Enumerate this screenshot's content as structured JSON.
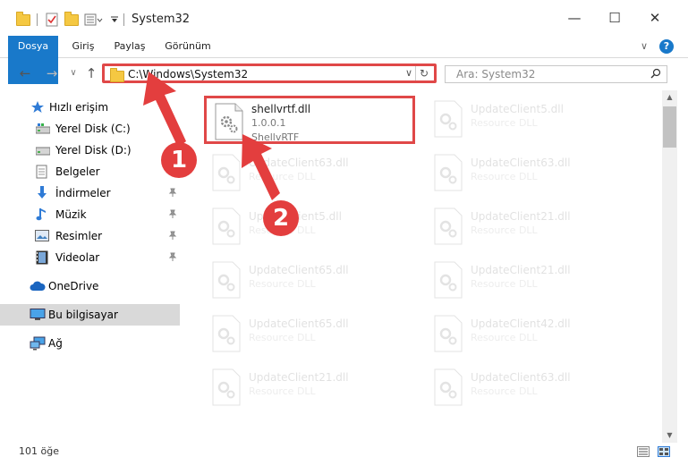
{
  "window": {
    "title": "System32",
    "controls": {
      "minimize": "—",
      "maximize": "☐",
      "close": "✕"
    }
  },
  "ribbon": {
    "tabs": [
      "Dosya",
      "Giriş",
      "Paylaş",
      "Görünüm"
    ],
    "expand": "∨",
    "help": "?"
  },
  "navigation": {
    "back": "←",
    "forward": "→",
    "recent": "∨",
    "up": "↑"
  },
  "address": {
    "path": "C:\\Windows\\System32",
    "dropdown": "∨",
    "refresh": "↻"
  },
  "search": {
    "placeholder": "Ara: System32",
    "icon": "search-icon"
  },
  "sidebar": {
    "items": [
      {
        "label": "Hızlı erişim",
        "icon": "star-icon"
      },
      {
        "label": "Yerel Disk (C:)",
        "icon": "drive-icon",
        "pinned": true
      },
      {
        "label": "Yerel Disk (D:)",
        "icon": "drive-icon"
      },
      {
        "label": "Belgeler",
        "icon": "documents-icon"
      },
      {
        "label": "İndirmeler",
        "icon": "download-icon",
        "pinned": true
      },
      {
        "label": "Müzik",
        "icon": "music-icon",
        "pinned": true
      },
      {
        "label": "Resimler",
        "icon": "pictures-icon",
        "pinned": true
      },
      {
        "label": "Videolar",
        "icon": "video-icon",
        "pinned": true
      },
      {
        "label": "OneDrive",
        "icon": "cloud-icon"
      },
      {
        "label": "Bu bilgisayar",
        "icon": "computer-icon",
        "selected": true
      },
      {
        "label": "Ağ",
        "icon": "network-icon"
      }
    ],
    "pin": "📌"
  },
  "files": {
    "highlighted": {
      "name": "shellvrtf.dll",
      "version": "1.0.0.1",
      "description": "ShellvRTF"
    },
    "left": [
      {
        "name": "UpdateClient63.dll",
        "desc": "Resource DLL"
      },
      {
        "name": "UpdateClient5.dll",
        "desc": "Resource DLL"
      },
      {
        "name": "UpdateClient65.dll",
        "desc": "Resource DLL"
      },
      {
        "name": "UpdateClient65.dll",
        "desc": "Resource DLL"
      },
      {
        "name": "UpdateClient21.dll",
        "desc": "Resource DLL"
      }
    ],
    "right": [
      {
        "name": "UpdateClient5.dll",
        "desc": "Resource DLL"
      },
      {
        "name": "UpdateClient63.dll",
        "desc": "Resource DLL"
      },
      {
        "name": "UpdateClient21.dll",
        "desc": "Resource DLL"
      },
      {
        "name": "UpdateClient21.dll",
        "desc": "Resource DLL"
      },
      {
        "name": "UpdateClient42.dll",
        "desc": "Resource DLL"
      },
      {
        "name": "UpdateClient63.dll",
        "desc": "Resource DLL"
      }
    ]
  },
  "status": {
    "count": "101 öğe"
  },
  "annotations": {
    "step1": "1",
    "step2": "2",
    "color": "#e33e3e"
  }
}
